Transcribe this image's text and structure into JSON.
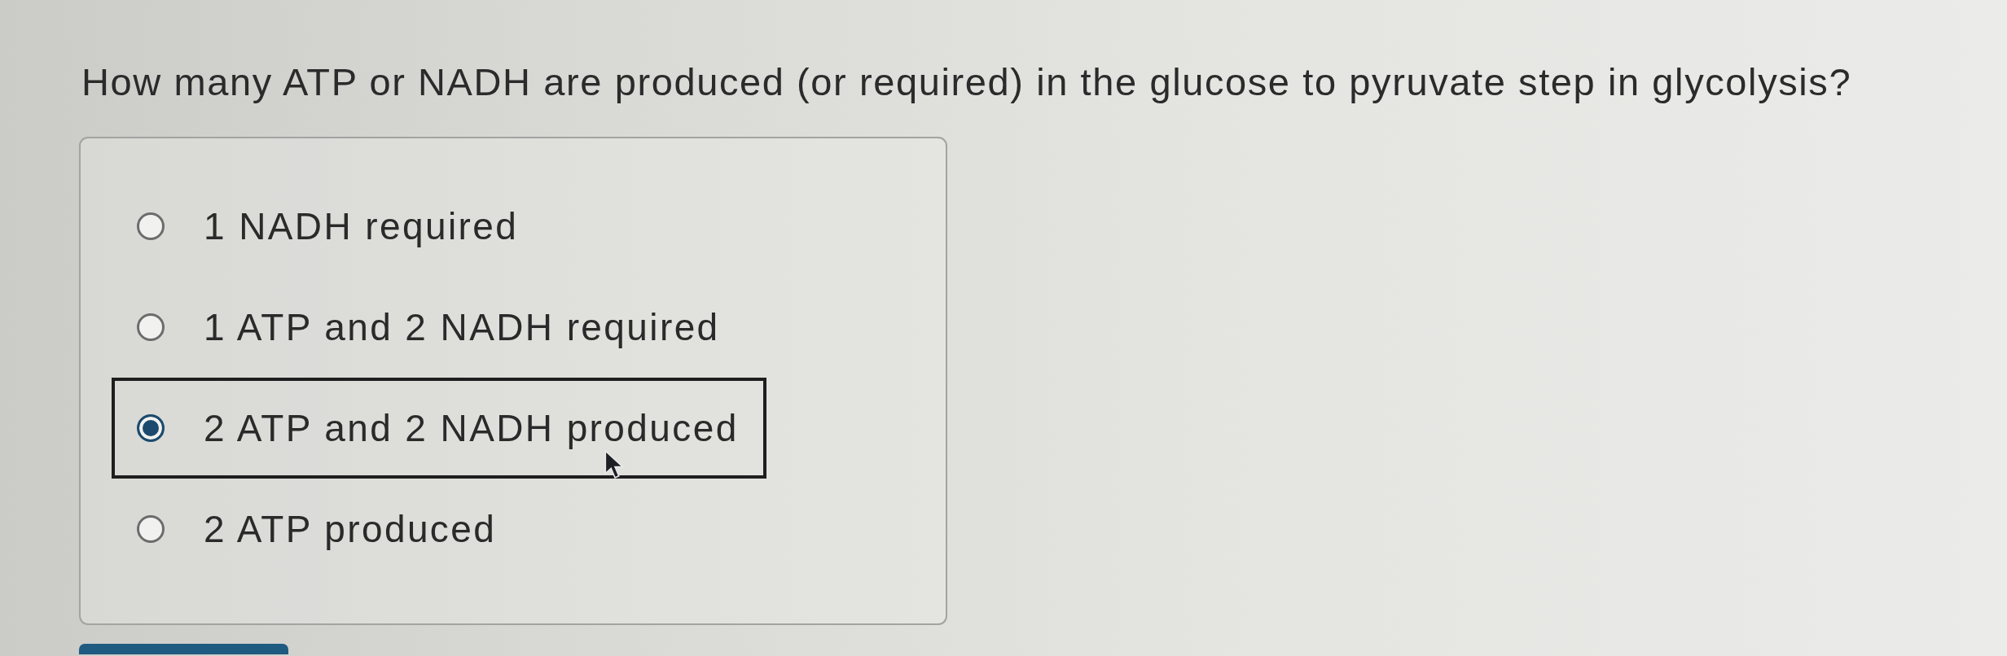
{
  "question": "How many ATP or NADH are produced (or required) in the glucose to pyruvate step in glycolysis?",
  "options": [
    {
      "label": "1 NADH required",
      "selected": false
    },
    {
      "label": "1 ATP and 2 NADH required",
      "selected": false
    },
    {
      "label": "2 ATP and 2 NADH produced",
      "selected": true
    },
    {
      "label": "2 ATP produced",
      "selected": false
    }
  ]
}
